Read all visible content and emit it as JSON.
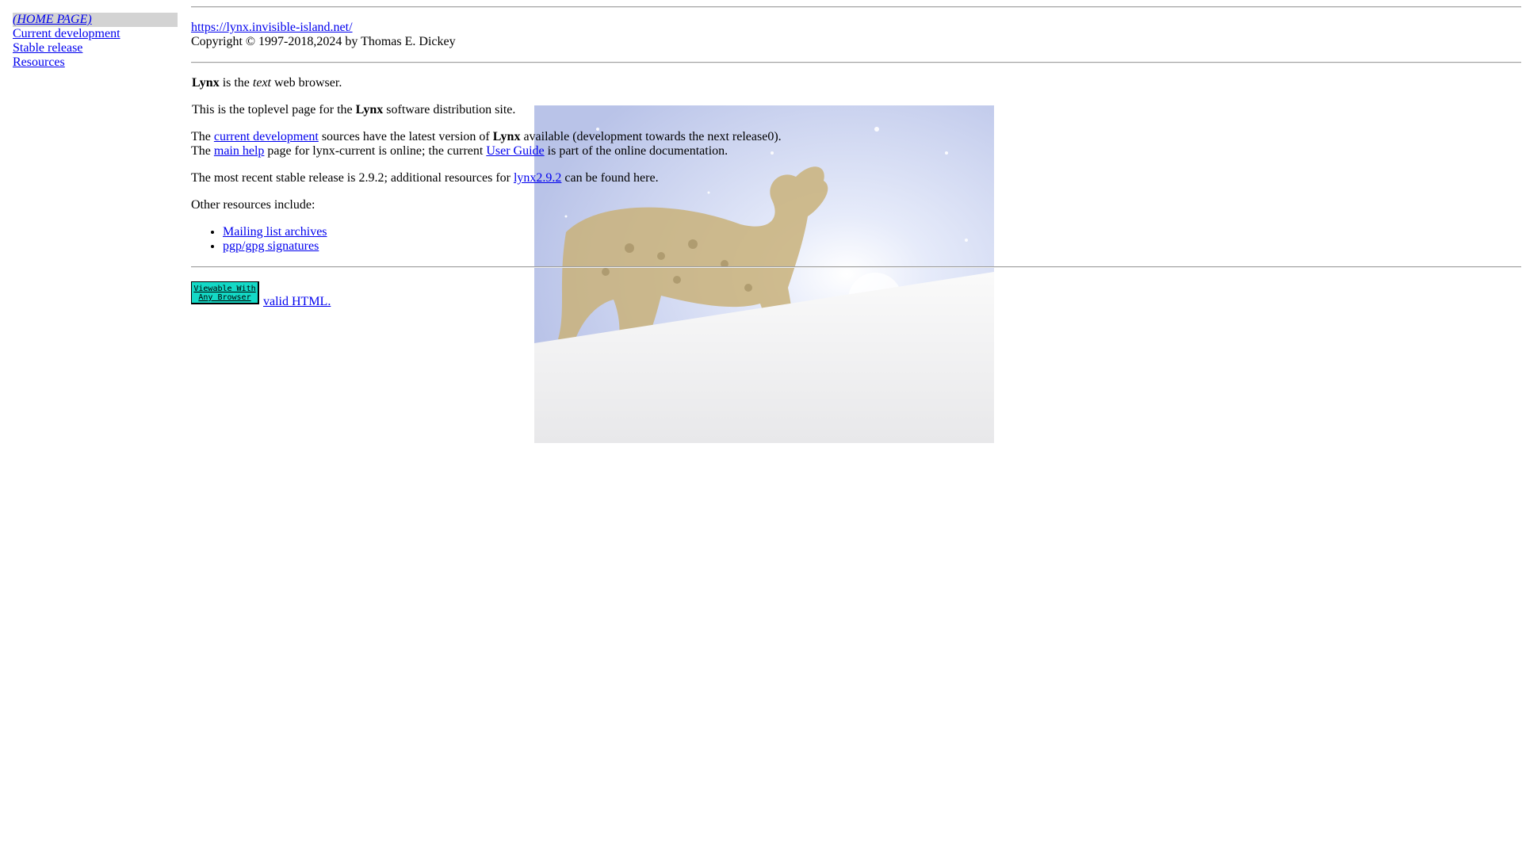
{
  "nav": {
    "items": [
      {
        "label": "(HOME PAGE)"
      },
      {
        "label": "Current development"
      },
      {
        "label": "Stable release"
      },
      {
        "label": "Resources"
      }
    ]
  },
  "header": {
    "url": "https://lynx.invisible-island.net/",
    "copyright": "Copyright © 1997-2018,2024 by Thomas E. Dickey"
  },
  "intro": {
    "p1": {
      "b": "Lynx",
      "t1": " is the ",
      "i": "text",
      "t2": " web browser."
    },
    "p2": {
      "t1": "This is the toplevel page for the ",
      "b": "Lynx",
      "t2": " software distribution site."
    }
  },
  "dev": {
    "l1": {
      "t1": "The ",
      "link": "current development",
      "t2": " sources have the latest version of ",
      "b": "Lynx",
      "t3": " available (development towards the next release0)."
    },
    "l2": {
      "t1": "The ",
      "link1": "main help",
      "t2": " page for lynx-current is online; the current ",
      "link2": "User Guide",
      "t3": " is part of the online documentation."
    }
  },
  "stable": {
    "t1": "The most recent stable release is 2.9.2; additional resources for ",
    "link": "lynx2.9.2",
    "t2": " can be found here."
  },
  "resources": {
    "intro": "Other resources include:",
    "items": [
      {
        "label": "Mailing list archives"
      },
      {
        "label": "pgp/gpg signatures"
      }
    ]
  },
  "footer": {
    "badge_line1": "Viewable With",
    "badge_line2": "Any Browser",
    "valid_link": "valid HTML."
  },
  "colors": {
    "link": "#0000ee",
    "nav_highlight": "#d3d3d3",
    "badge": "#14d9c6"
  },
  "icons": {
    "background_art": "lynx-illustration"
  }
}
